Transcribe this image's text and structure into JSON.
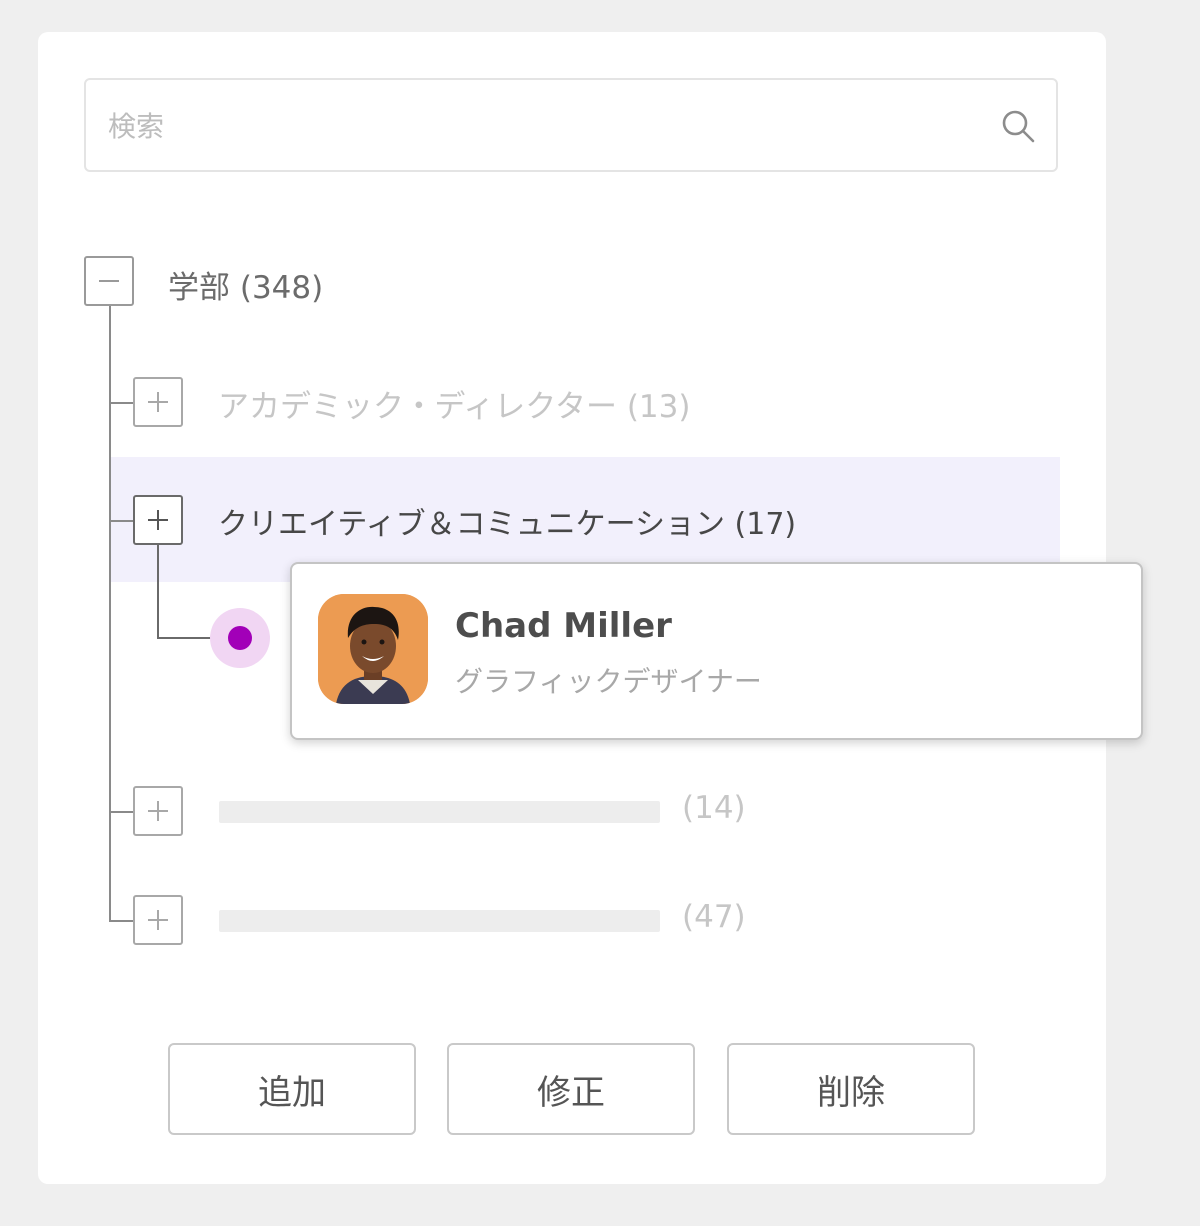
{
  "search": {
    "placeholder": "検索",
    "value": ""
  },
  "tree": {
    "root": {
      "label": "学部 (348)",
      "expanded": true
    },
    "items": [
      {
        "label": "アカデミック・ディレクター (13)",
        "state": "faded"
      },
      {
        "label": "クリエイティブ＆コミュニケーション (17)",
        "state": "active"
      },
      {
        "count": "(14)",
        "state": "placeholder"
      },
      {
        "count": "(47)",
        "state": "placeholder"
      }
    ]
  },
  "profile_card": {
    "name": "Chad Miller",
    "role": "グラフィックデザイナー",
    "avatar_bg": "#ec9b52"
  },
  "actions": {
    "add": "追加",
    "edit": "修正",
    "delete": "削除"
  },
  "colors": {
    "highlight_row": "#f2f0fc",
    "node_accent": "#a200b8",
    "node_halo": "#f1d6f3"
  }
}
